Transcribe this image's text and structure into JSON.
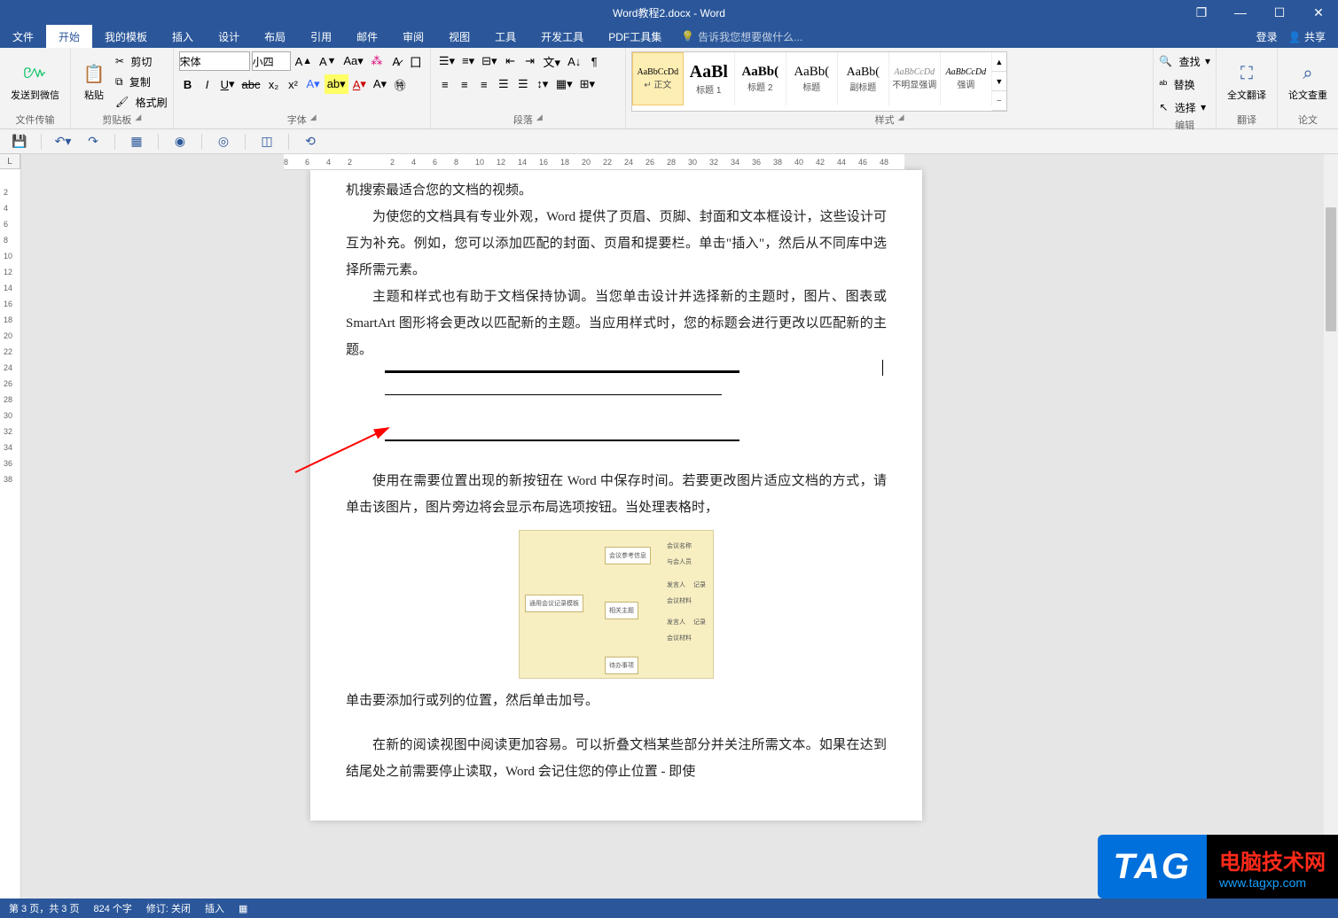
{
  "titlebar": {
    "title": "Word教程2.docx - Word"
  },
  "window_controls": {
    "restore": "❐",
    "minimize": "—",
    "maximize": "☐",
    "close": "✕"
  },
  "tabs": {
    "file": "文件",
    "home": "开始",
    "templates": "我的模板",
    "insert": "插入",
    "design": "设计",
    "layout": "布局",
    "references": "引用",
    "mailings": "邮件",
    "review": "审阅",
    "view": "视图",
    "tools": "工具",
    "dev": "开发工具",
    "pdf": "PDF工具集",
    "tell_me": "告诉我您想要做什么...",
    "login": "登录",
    "share": "共享"
  },
  "ribbon": {
    "wechat": {
      "label": "发送到微信",
      "group": "文件传输"
    },
    "clipboard": {
      "paste": "粘贴",
      "cut": "剪切",
      "copy": "复制",
      "painter": "格式刷",
      "group": "剪贴板"
    },
    "font": {
      "name": "宋体",
      "size": "小四",
      "group": "字体"
    },
    "paragraph": {
      "group": "段落"
    },
    "styles": {
      "group": "样式",
      "items": [
        {
          "preview": "AaBbCcDd",
          "name": "↵ 正文"
        },
        {
          "preview": "AaBl",
          "name": "标题 1"
        },
        {
          "preview": "AaBb(",
          "name": "标题 2"
        },
        {
          "preview": "AaBb(",
          "name": "标题"
        },
        {
          "preview": "AaBb(",
          "name": "副标题"
        },
        {
          "preview": "AaBbCcDd",
          "name": "不明显强调"
        },
        {
          "preview": "AaBbCcDd",
          "name": "强调"
        }
      ]
    },
    "editing": {
      "find": "查找",
      "replace": "替换",
      "select": "选择",
      "group": "编辑"
    },
    "translate": {
      "label": "全文翻译",
      "group": "翻译"
    },
    "thesis": {
      "label": "论文查重",
      "group": "论文"
    }
  },
  "hruler_ticks": [
    "8",
    "6",
    "4",
    "2",
    "",
    "2",
    "4",
    "6",
    "8",
    "10",
    "12",
    "14",
    "16",
    "18",
    "20",
    "22",
    "24",
    "26",
    "28",
    "30",
    "32",
    "34",
    "36",
    "38",
    "40",
    "42",
    "44",
    "46",
    "48"
  ],
  "vruler_ticks": [
    "",
    "2",
    "4",
    "6",
    "8",
    "10",
    "12",
    "14",
    "16",
    "18",
    "20",
    "22",
    "24",
    "26",
    "28",
    "30",
    "32",
    "34",
    "36",
    "38"
  ],
  "document": {
    "p1": "机搜索最适合您的文档的视频。",
    "p2": "为使您的文档具有专业外观，Word 提供了页眉、页脚、封面和文本框设计，这些设计可互为补充。例如，您可以添加匹配的封面、页眉和提要栏。单击\"插入\"，然后从不同库中选择所需元素。",
    "p3": "主题和样式也有助于文档保持协调。当您单击设计并选择新的主题时，图片、图表或 SmartArt 图形将会更改以匹配新的主题。当应用样式时，您的标题会进行更改以匹配新的主题。",
    "p4": "使用在需要位置出现的新按钮在 Word 中保存时间。若要更改图片适应文档的方式，请单击该图片，图片旁边将会显示布局选项按钮。当处理表格时，",
    "p5": "单击要添加行或列的位置，然后单击加号。",
    "p6": "在新的阅读视图中阅读更加容易。可以折叠文档某些部分并关注所需文本。如果在达到结尾处之前需要停止读取，Word 会记住您的停止位置 - 即使"
  },
  "diagram": {
    "root": "通用会议记录模板",
    "n1": "会议参考信息",
    "n2": "相关主题",
    "n3": "待办事项",
    "leaf1a": "会议名称",
    "leaf1b": "与会人员",
    "leaf2a": "发言人",
    "leaf2a2": "记录",
    "leaf2b": "会议材料",
    "leaf2c": "发言人",
    "leaf2c2": "记录",
    "leaf2d": "会议材料"
  },
  "status": {
    "page": "第 3 页，共 3 页",
    "words": "824 个字",
    "track": "修订: 关闭",
    "mode": "插入"
  },
  "watermark": {
    "tag": "TAG",
    "line1": "电脑技术网",
    "line2": "www.tagxp.com"
  }
}
